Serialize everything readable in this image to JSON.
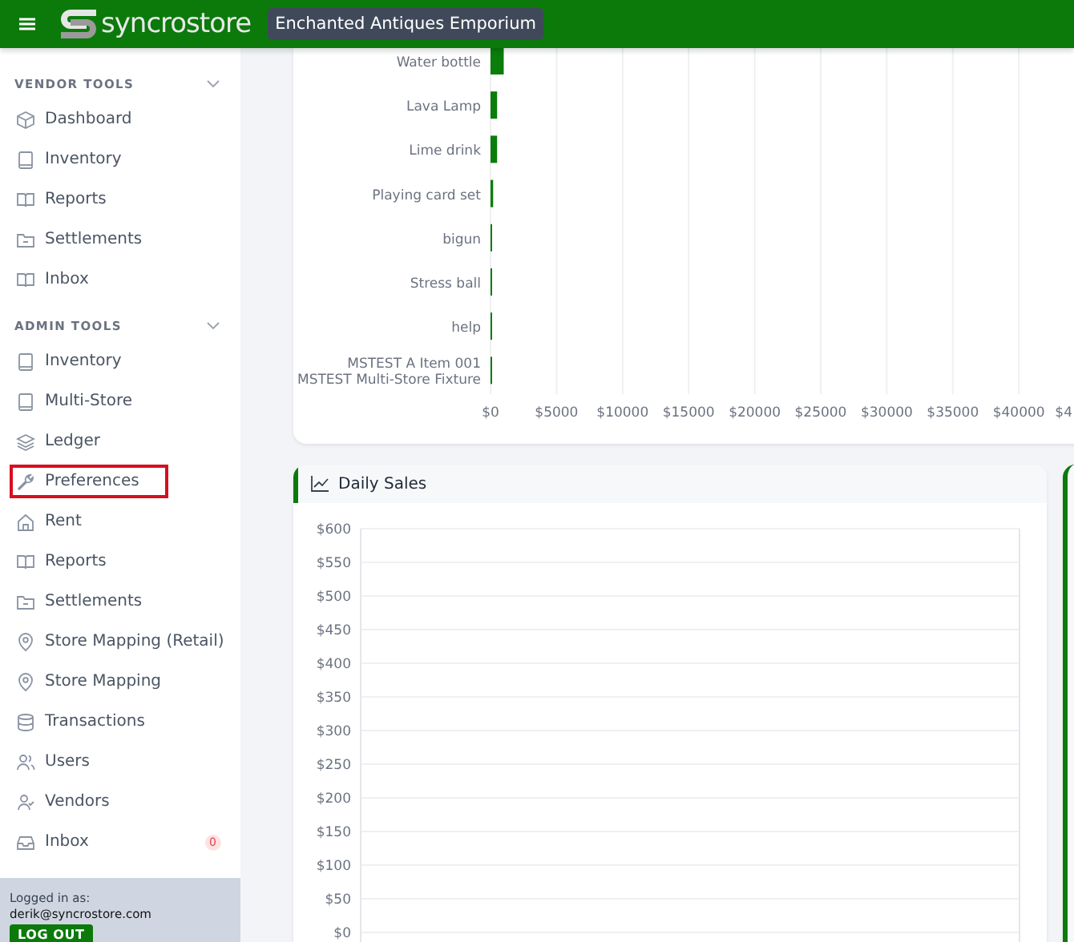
{
  "header": {
    "brand": "syncrostore",
    "store_selector": "Enchanted Antiques Emporium"
  },
  "sidebar": {
    "sections": [
      {
        "title": "VENDOR TOOLS",
        "expanded": true,
        "items": [
          {
            "kind": "cube",
            "label": "Dashboard",
            "highlighted": false
          },
          {
            "kind": "book",
            "label": "Inventory",
            "highlighted": false
          },
          {
            "kind": "book-open",
            "label": "Reports",
            "highlighted": false
          },
          {
            "kind": "folder",
            "label": "Settlements",
            "highlighted": false
          },
          {
            "kind": "book-open",
            "label": "Inbox",
            "highlighted": false
          }
        ]
      },
      {
        "title": "ADMIN TOOLS",
        "expanded": true,
        "items": [
          {
            "kind": "book",
            "label": "Inventory",
            "highlighted": false
          },
          {
            "kind": "book",
            "label": "Multi-Store",
            "highlighted": false
          },
          {
            "kind": "layers",
            "label": "Ledger",
            "highlighted": false
          },
          {
            "kind": "wrench",
            "label": "Preferences",
            "highlighted": true
          },
          {
            "kind": "home",
            "label": "Rent",
            "highlighted": false
          },
          {
            "kind": "book-open",
            "label": "Reports",
            "highlighted": false
          },
          {
            "kind": "folder",
            "label": "Settlements",
            "highlighted": false
          },
          {
            "kind": "pin",
            "label": "Store Mapping (Retail)",
            "highlighted": false
          },
          {
            "kind": "pin",
            "label": "Store Mapping",
            "highlighted": false
          },
          {
            "kind": "database",
            "label": "Transactions",
            "highlighted": false
          },
          {
            "kind": "users",
            "label": "Users",
            "highlighted": false
          },
          {
            "kind": "user-check",
            "label": "Vendors",
            "highlighted": false
          },
          {
            "kind": "inbox",
            "label": "Inbox",
            "highlighted": false,
            "badge": "0"
          }
        ]
      }
    ],
    "footer": {
      "label": "Logged in as:",
      "email": "derik@syncrostore.com",
      "button": "LOG OUT"
    }
  },
  "top_items_chart": {
    "chart_data": {
      "type": "bar",
      "orientation": "horizontal",
      "categories": [
        "Water bottle",
        "Lava Lamp",
        "Lime drink",
        "Playing card set",
        "bigun",
        "Stress ball",
        "help",
        "MSTEST A Item 001\nMSTEST Multi-Store Fixture"
      ],
      "series": [
        {
          "color": "#0a7d0a",
          "values": [
            1000,
            500,
            500,
            200,
            100,
            100,
            100,
            100
          ]
        }
      ],
      "grid": true,
      "xlim": [
        0,
        40000
      ],
      "xticks": [
        {
          "value": 0,
          "label": "$0"
        },
        {
          "value": 5000,
          "label": "$5000"
        },
        {
          "value": 10000,
          "label": "$10000"
        },
        {
          "value": 15000,
          "label": "$15000"
        },
        {
          "value": 20000,
          "label": "$20000"
        },
        {
          "value": 25000,
          "label": "$25000"
        },
        {
          "value": 30000,
          "label": "$30000"
        },
        {
          "value": 35000,
          "label": "$35000"
        },
        {
          "value": 40000,
          "label": "$40000"
        }
      ]
    },
    "clipped_tick_label": "$4"
  },
  "daily_sales": {
    "title": "Daily Sales",
    "axis_labels": [
      "$600",
      "$550",
      "$500",
      "$450",
      "$400",
      "$350",
      "$300",
      "$250",
      "$200",
      "$150",
      "$100",
      "$50",
      "$0"
    ]
  }
}
